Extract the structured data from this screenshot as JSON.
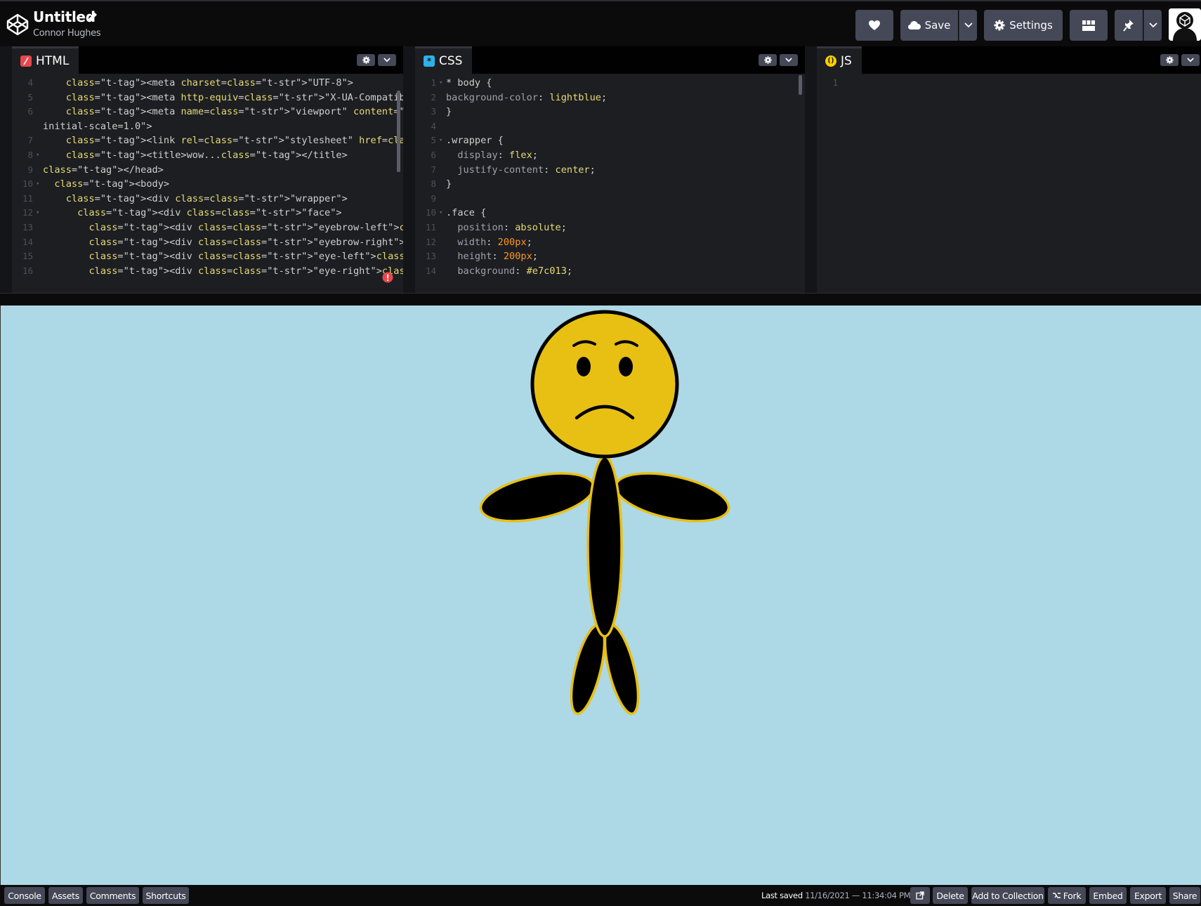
{
  "header": {
    "title": "Untitled",
    "author": "Connor Hughes",
    "save_label": "Save",
    "settings_label": "Settings"
  },
  "editors": {
    "html": {
      "tab_label": "HTML",
      "lines": [
        {
          "n": "4",
          "fold": false,
          "code": "    <meta charset=\"UTF-8\">"
        },
        {
          "n": "5",
          "fold": false,
          "code": "    <meta http-equiv=\"X-UA-Compatible\" content=\"IE=edge\">"
        },
        {
          "n": "6",
          "fold": false,
          "code": "    <meta name=\"viewport\" content=\"width=device-width,"
        },
        {
          "n": "",
          "fold": false,
          "code": "initial-scale=1.0\">"
        },
        {
          "n": "7",
          "fold": false,
          "code": "    <link rel=\"stylesheet\" href=\"css_smiley.css\">"
        },
        {
          "n": "8",
          "fold": true,
          "code": "    <title>wow...</title>"
        },
        {
          "n": "9",
          "fold": false,
          "code": "</head>"
        },
        {
          "n": "10",
          "fold": true,
          "code": "  <body>"
        },
        {
          "n": "11",
          "fold": false,
          "code": "    <div class=\"wrapper\">"
        },
        {
          "n": "12",
          "fold": true,
          "code": "      <div class=\"face\">"
        },
        {
          "n": "13",
          "fold": false,
          "code": "        <div class=\"eyebrow-left\"></div>"
        },
        {
          "n": "14",
          "fold": false,
          "code": "        <div class=\"eyebrow-right\"></div>"
        },
        {
          "n": "15",
          "fold": false,
          "code": "        <div class=\"eye-left\"></div>"
        },
        {
          "n": "16",
          "fold": false,
          "code": "        <div class=\"eye-right\"></div>"
        }
      ]
    },
    "css": {
      "tab_label": "CSS",
      "lines": [
        {
          "n": "1",
          "fold": true,
          "code": "* body {"
        },
        {
          "n": "2",
          "fold": false,
          "code": "background-color: lightblue;"
        },
        {
          "n": "3",
          "fold": false,
          "code": "}"
        },
        {
          "n": "4",
          "fold": false,
          "code": ""
        },
        {
          "n": "5",
          "fold": true,
          "code": ".wrapper {"
        },
        {
          "n": "6",
          "fold": false,
          "code": "  display: flex;"
        },
        {
          "n": "7",
          "fold": false,
          "code": "  justify-content: center;"
        },
        {
          "n": "8",
          "fold": false,
          "code": "}"
        },
        {
          "n": "9",
          "fold": false,
          "code": ""
        },
        {
          "n": "10",
          "fold": true,
          "code": ".face {"
        },
        {
          "n": "11",
          "fold": false,
          "code": "  position: absolute;"
        },
        {
          "n": "12",
          "fold": false,
          "code": "  width: 200px;"
        },
        {
          "n": "13",
          "fold": false,
          "code": "  height: 200px;"
        },
        {
          "n": "14",
          "fold": false,
          "code": "  background: #e7c013;"
        }
      ]
    },
    "js": {
      "tab_label": "JS",
      "lines": [
        {
          "n": "1",
          "fold": false,
          "code": ""
        }
      ]
    }
  },
  "footer": {
    "console": "Console",
    "assets": "Assets",
    "comments": "Comments",
    "shortcuts": "Shortcuts",
    "last_saved_label": "Last saved",
    "last_saved_time": "11/16/2021 — 11:34:04 PM",
    "delete": "Delete",
    "add_to_collection": "Add to Collection",
    "fork": "Fork",
    "embed": "Embed",
    "export": "Export",
    "share": "Share"
  },
  "colors": {
    "background": "#add8e6",
    "face": "#e7c013",
    "html_icon": "#e8474c",
    "css_icon": "#2fb1e8",
    "js_icon": "#fcd000"
  },
  "icons": [
    "codepen-logo-icon",
    "pencil-icon",
    "heart-icon",
    "cloud-icon",
    "chevron-down-icon",
    "gear-icon",
    "layout-grid-icon",
    "pin-icon",
    "error-icon",
    "external-link-icon",
    "fork-icon"
  ]
}
